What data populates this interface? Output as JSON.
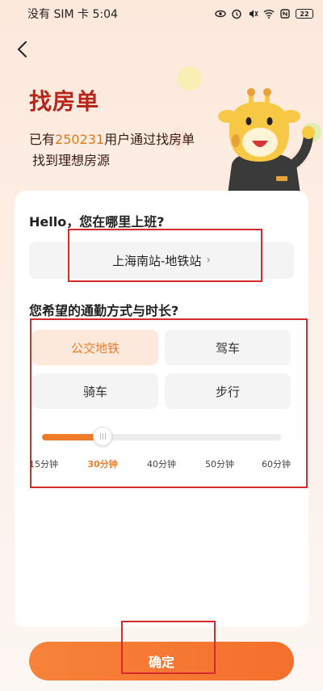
{
  "status_bar": {
    "carrier_time": "没有 SIM 卡 5:04",
    "battery": "22"
  },
  "header": {
    "title": "找房单",
    "subtitle_prefix": "已有",
    "subtitle_count": "250231",
    "subtitle_suffix": "用户通过找房单",
    "subtitle_line2": "找到理想房源"
  },
  "workplace": {
    "question": "Hello，您在哪里上班?",
    "location": "上海南站-地铁站",
    "chevron": "›"
  },
  "commute": {
    "question": "您希望的通勤方式与时长?",
    "modes": [
      {
        "label": "公交地铁",
        "active": true
      },
      {
        "label": "驾车",
        "active": false
      },
      {
        "label": "骑车",
        "active": false
      },
      {
        "label": "步行",
        "active": false
      }
    ],
    "duration_ticks": [
      "15分钟",
      "30分钟",
      "40分钟",
      "50分钟",
      "60分钟"
    ],
    "selected_tick_index": 1,
    "selected_fraction": 0.25
  },
  "confirm": {
    "label": "确定"
  },
  "colors": {
    "accent": "#f07c2a",
    "title": "#b6261b",
    "annotation": "#d62b2b"
  }
}
